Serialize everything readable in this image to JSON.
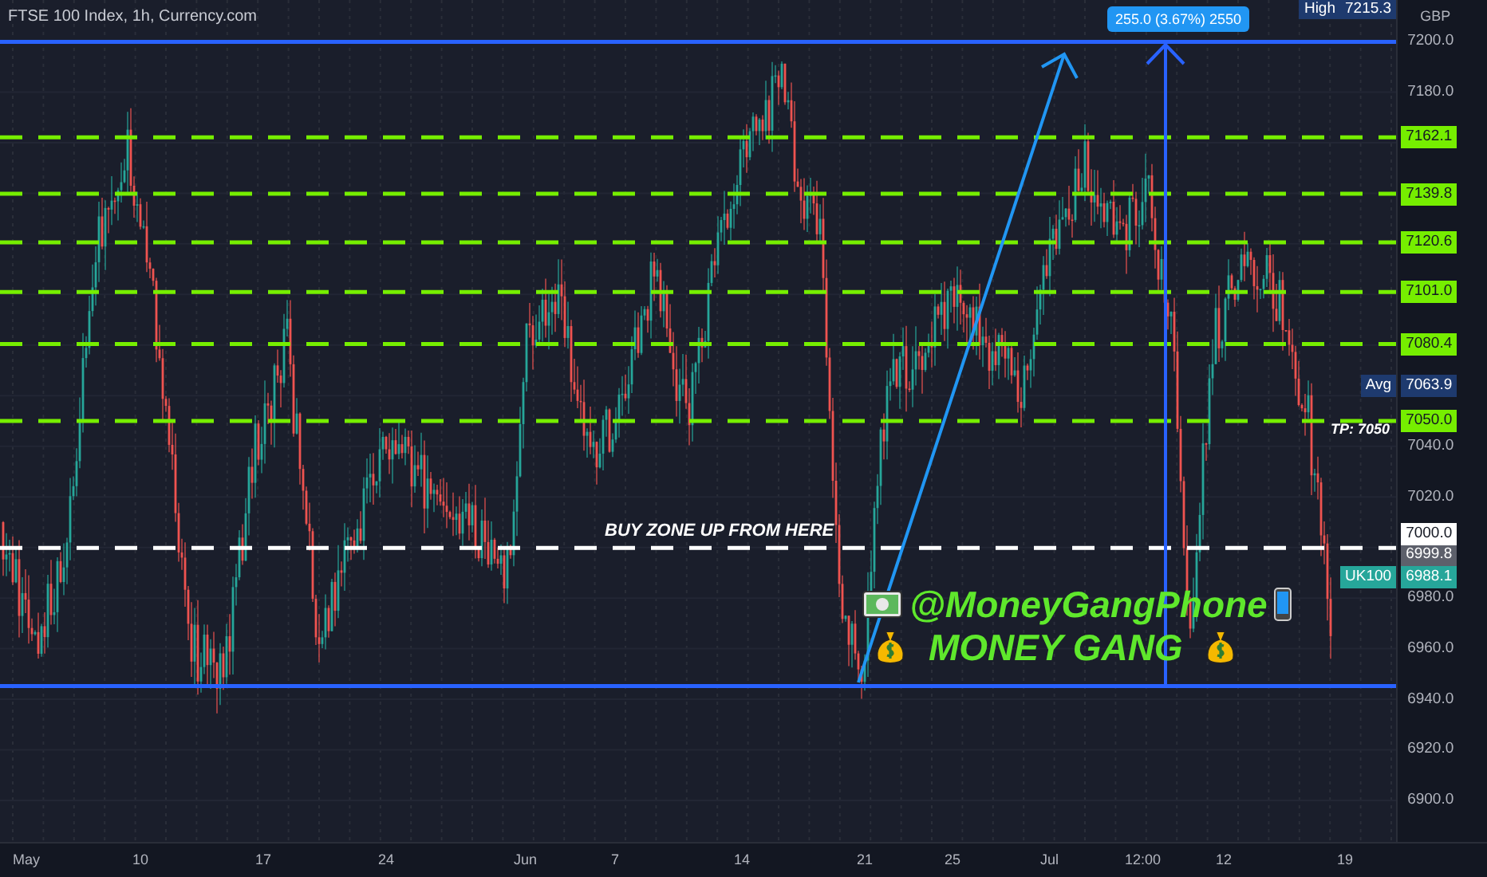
{
  "chart": {
    "title": "FTSE 100 Index, 1h, Currency.com",
    "currency": "GBP",
    "high_tag": {
      "label": "High",
      "price": "7215.3"
    },
    "measure_label": "255.0 (3.67%) 2550",
    "price_ticks": [
      "7200.0",
      "7180.0",
      "7040.0",
      "7020.0",
      "6980.0",
      "6960.0",
      "6940.0",
      "6920.0",
      "6900.0"
    ],
    "time_ticks": [
      "May",
      "10",
      "17",
      "24",
      "Jun",
      "7",
      "14",
      "21",
      "25",
      "Jul",
      "12:00",
      "12",
      "19"
    ],
    "levels": [
      {
        "price": "7162.1",
        "kind": "target"
      },
      {
        "price": "7139.8",
        "kind": "target"
      },
      {
        "price": "7120.6",
        "kind": "target"
      },
      {
        "price": "7101.0",
        "kind": "target"
      },
      {
        "price": "7080.4",
        "kind": "target"
      },
      {
        "price": "7050.0",
        "kind": "target"
      },
      {
        "price": "6999.8",
        "kind": "entry"
      }
    ],
    "tags": [
      {
        "kind": "avg",
        "label": "Avg",
        "price": "7063.9"
      },
      {
        "kind": "cursor",
        "price": "7000.0"
      },
      {
        "kind": "symbol",
        "label": "UK100",
        "price": "6988.1"
      }
    ],
    "notes": [
      {
        "kind": "tp",
        "text": "TP: 7050"
      },
      {
        "kind": "zone",
        "text": "BUY ZONE UP FROM HERE"
      }
    ],
    "promo": {
      "handle": "@MoneyGangPhone",
      "slogan": "MONEY GANG"
    }
  }
}
